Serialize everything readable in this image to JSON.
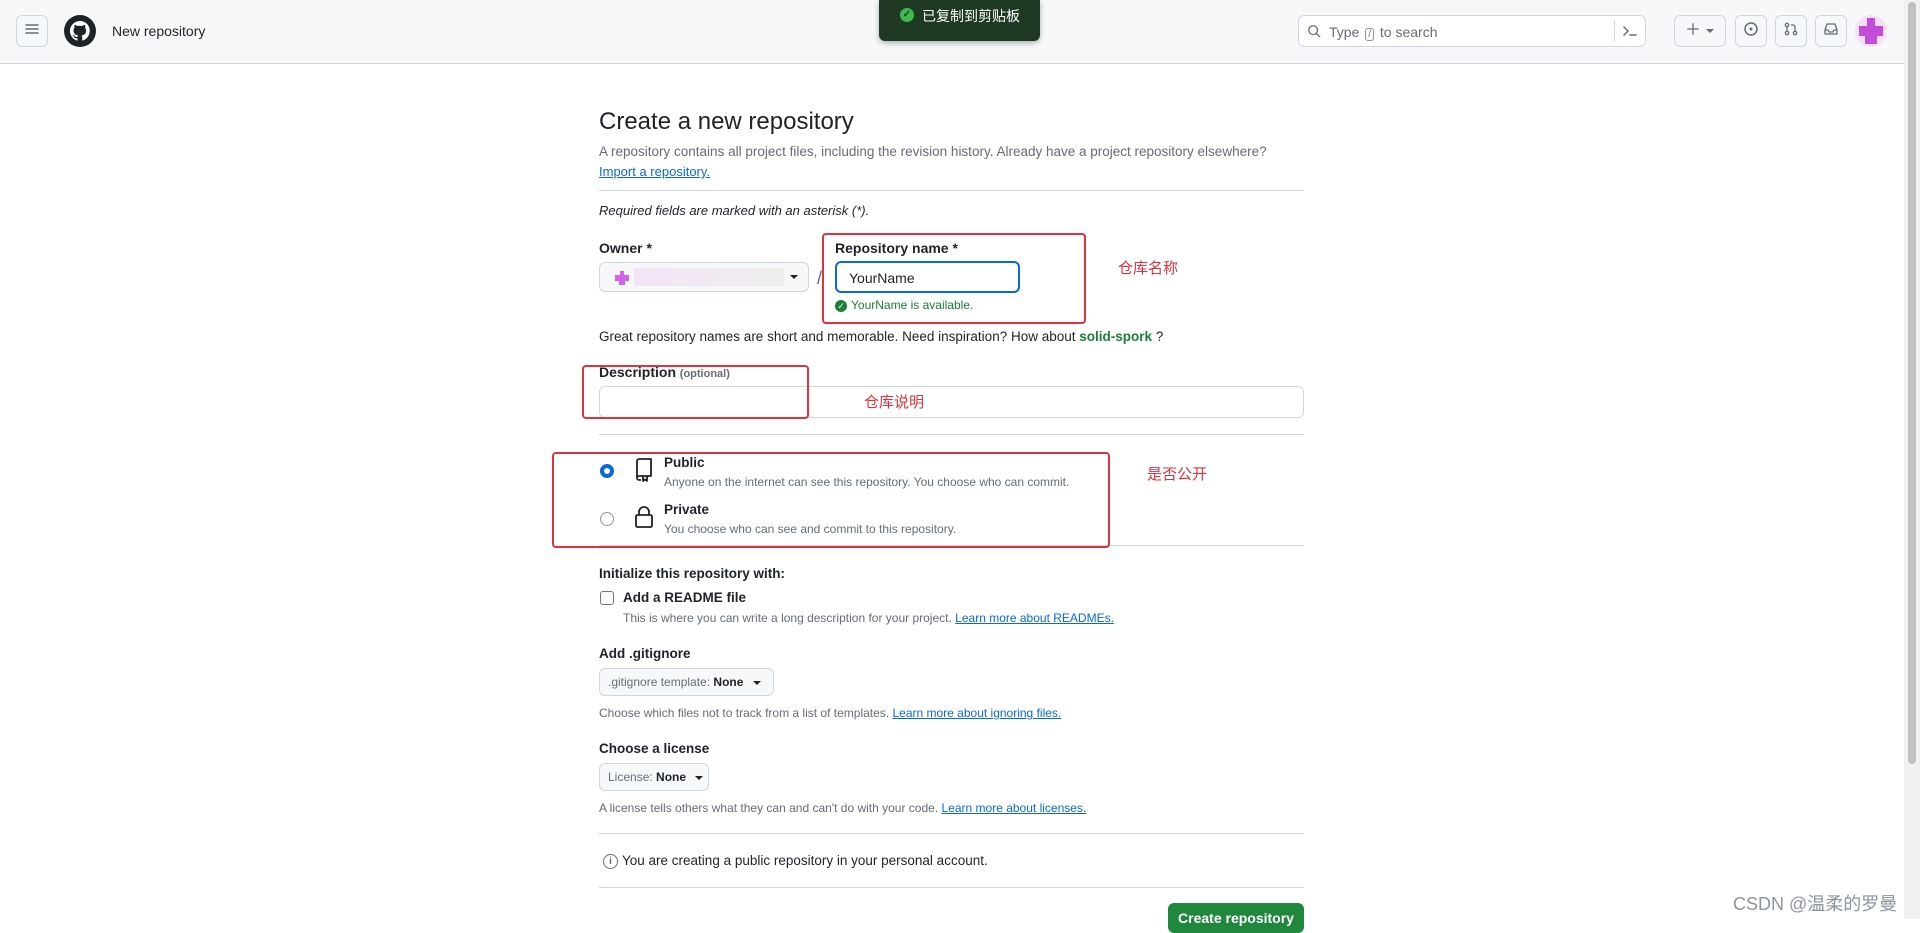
{
  "header": {
    "page_title": "New repository",
    "search_placeholder_prefix": "Type",
    "search_key": "/",
    "search_placeholder_suffix": "to search"
  },
  "toast": {
    "text": "已复制到剪贴板"
  },
  "form": {
    "title": "Create a new repository",
    "intro": "A repository contains all project files, including the revision history. Already have a project repository elsewhere?",
    "import_link": "Import a repository.",
    "required_note": "Required fields are marked with an asterisk (*).",
    "owner_label": "Owner *",
    "slash": "/",
    "repo_label": "Repository name *",
    "repo_value": "YourName",
    "availability": "YourName is available.",
    "suggestion_text": "Great repository names are short and memorable. Need inspiration? How about",
    "suggestion_name": "solid-spork",
    "suggestion_end": "?",
    "description_label": "Description",
    "description_optional": "(optional)",
    "visibility": [
      {
        "label": "Public",
        "desc": "Anyone on the internet can see this repository. You choose who can commit.",
        "selected": true
      },
      {
        "label": "Private",
        "desc": "You choose who can see and commit to this repository.",
        "selected": false
      }
    ],
    "init_heading": "Initialize this repository with:",
    "readme_label": "Add a README file",
    "readme_desc": "This is where you can write a long description for your project.",
    "readme_link": "Learn more about READMEs.",
    "gitignore_heading": "Add .gitignore",
    "gitignore_select_prefix": ".gitignore template:",
    "gitignore_select_value": "None",
    "gitignore_desc": "Choose which files not to track from a list of templates.",
    "gitignore_link": "Learn more about ignoring files.",
    "license_heading": "Choose a license",
    "license_select_prefix": "License:",
    "license_select_value": "None",
    "license_desc": "A license tells others what they can and can't do with your code.",
    "license_link": "Learn more about licenses.",
    "notice": "You are creating a public repository in your personal account.",
    "create_button": "Create repository"
  },
  "annotations": {
    "repo_name": "仓库名称",
    "description": "仓库说明",
    "visibility": "是否公开"
  },
  "watermark": "CSDN @温柔的罗曼",
  "colors": {
    "accent": "#0969da",
    "success": "#1a7f37",
    "annotation_red": "#e0313e",
    "create_button": "#1f883d"
  }
}
